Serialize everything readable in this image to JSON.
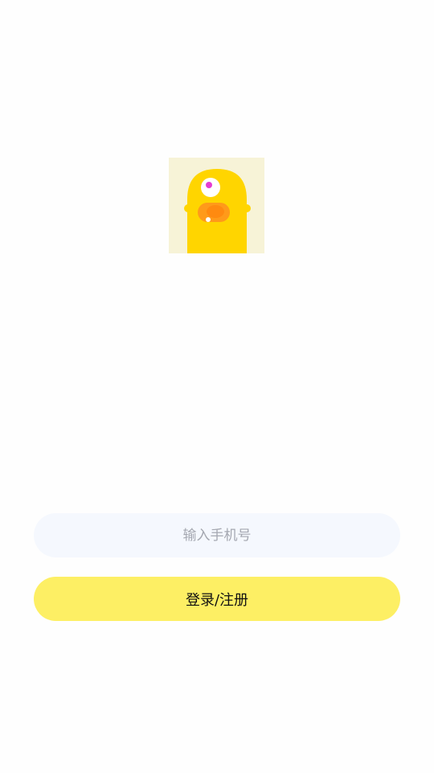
{
  "logo": {
    "icon": "yellow-one-eyed-monster-mascot",
    "colors": {
      "background": "#f7f3d7",
      "body": "#ffd500",
      "mouth": "#ff9a1a",
      "eye": "#ffffff",
      "pupil": "#e53dd2"
    }
  },
  "login_form": {
    "phone_placeholder": "输入手机号",
    "phone_value": "",
    "submit_label": "登录/注册"
  },
  "colors": {
    "page_background": "#fefefe",
    "input_background": "#f5f8fe",
    "button_background": "#fdef64"
  }
}
